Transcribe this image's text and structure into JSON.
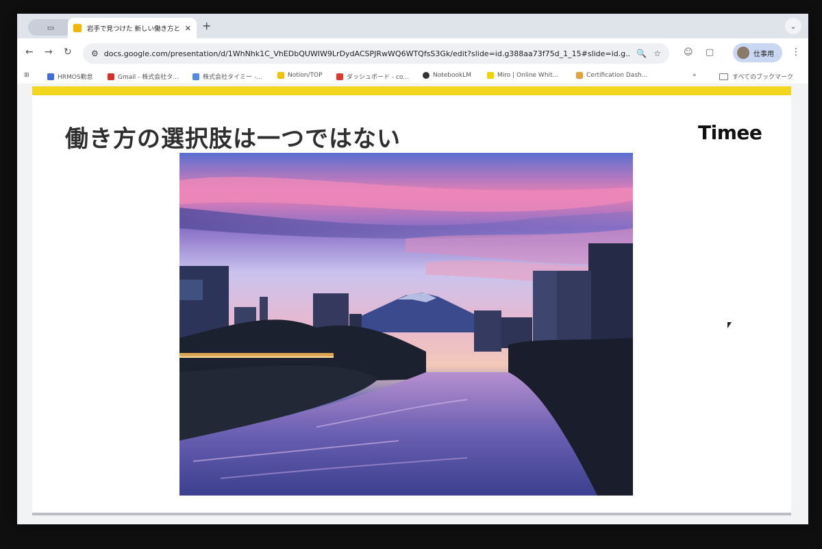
{
  "browser": {
    "tab_title": "岩手で見つけた 新しい働き方と…",
    "tab_close": "✕",
    "new_tab": "+",
    "url": "docs.google.com/presentation/d/1WhNhk1C_VhEDbQUWIW9LrDydACSPJRwWQ6WTQfsS3Gk/edit?slide=id.g388aa73f75d_1_15#slide=id.g...",
    "profile_label": "仕事用",
    "bookmarks": [
      {
        "label": "HRMOS勤怠",
        "color": "#3c6ee0"
      },
      {
        "label": "Gmail - 株式会社タ...",
        "color": "#d93025"
      },
      {
        "label": "株式会社タイミー -...",
        "color": "#4f8ae8"
      },
      {
        "label": "Notion/TOP",
        "color": "#f2c200"
      },
      {
        "label": "ダッシュボード - co...",
        "color": "#e2382c"
      },
      {
        "label": "NotebookLM",
        "color": "#333333"
      },
      {
        "label": "Miro | Online Whit...",
        "color": "#f2d300"
      },
      {
        "label": "Certification Dash...",
        "color": "#e6a23a"
      }
    ],
    "bookmarks_overflow": "»",
    "all_bookmarks": "すべてのブックマーク"
  },
  "slide": {
    "title": "働き方の選択肢は一つではない",
    "logo": "Timee",
    "accent_color": "#f3d71e"
  },
  "icons": {
    "back": "←",
    "forward": "→",
    "reload": "↻",
    "zoom": "🔍",
    "star": "☆",
    "menu": "⋮",
    "tab_search": "⌄"
  }
}
